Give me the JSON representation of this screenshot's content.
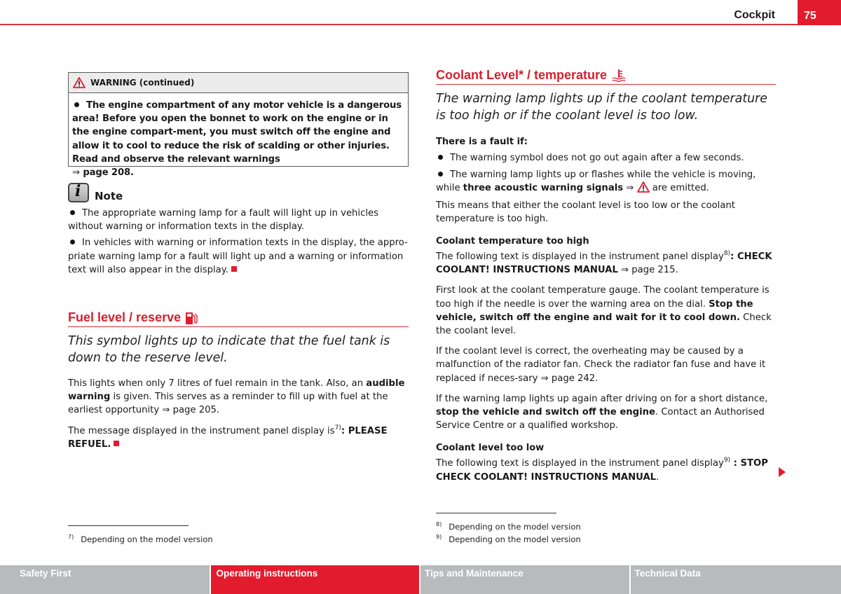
{
  "header": {
    "section_title": "Cockpit",
    "page_number": "75",
    "accent_color": "#e31c2d"
  },
  "warning_box": {
    "icon": "warning-triangle-icon",
    "title": "WARNING (continued)",
    "bullet_text": "The engine compartment of any motor vehicle is a dangerous area! Before you open the bonnet to work on the engine or in the engine compart-ment, you must switch off the engine and allow it to cool to reduce the risk of scalding or other injuries. Read and observe the relevant warnings",
    "ref_arrow": "⇒",
    "ref_page": "page 208."
  },
  "note": {
    "icon": "info-icon",
    "title": "Note",
    "items": [
      "The appropriate warning lamp for a fault will light up in vehicles without warning or information texts in the display.",
      "In vehicles with warning or information texts in the display, the appro-priate warning lamp for a fault will light up and a warning or information text will also appear in the display."
    ]
  },
  "fuel_section": {
    "title": "Fuel level / reserve",
    "icon": "fuel-pump-icon",
    "lead": "This symbol lights up to indicate that the fuel tank is down to the reserve level.",
    "p1_a": "This lights when only 7 litres of fuel remain in the tank. Also, an ",
    "p1_bold": "audible warning",
    "p1_b": " is given. This serves as a reminder to fill up with fuel at the earliest opportunity ",
    "p1_arrow": "⇒",
    "p1_page": " page 205.",
    "p2_a": "The message displayed in the instrument panel display is",
    "p2_sup": "7)",
    "p2_colon": ": ",
    "p2_bold": "PLEASE REFUEL",
    "p2_end": "."
  },
  "coolant_section": {
    "title": "Coolant Level* / temperature",
    "icon": "coolant-temperature-icon",
    "lead": "The warning lamp lights up if the coolant temperature is too high or if the coolant level is too low.",
    "fault_heading": "There is a fault if:",
    "fault_item1": "The warning symbol does not go out again after a few seconds.",
    "fault_item2_a": "The warning lamp lights up or flashes while the vehicle is moving, while ",
    "fault_item2_bold": "three acoustic warning signals",
    "fault_item2_arrow": " ⇒ ",
    "fault_item2_end": " are emitted.",
    "means": "This means that either the coolant level is too low or the coolant temperature is too high.",
    "temp_heading": "Coolant temperature too high",
    "temp_p1_a": "The following text is displayed in the instrument panel display",
    "temp_p1_sup": "8)",
    "temp_p1_colon": ": ",
    "temp_p1_bold": "CHECK COOLANT! INSTRUCTIONS MANUAL",
    "temp_p1_arrow": " ⇒ ",
    "temp_p1_page": "page 215.",
    "temp_p2_a": "First look at the coolant temperature gauge. The coolant temperature is too high if the needle is over the warning area on the dial. ",
    "temp_p2_bold": "Stop the vehicle, switch off the engine and wait for it to cool down.",
    "temp_p2_b": " Check the coolant level.",
    "temp_p3_a": "If the coolant level is correct, the overheating may be caused by a malfunction of the radiator fan. Check the radiator fan fuse and have it replaced if neces-sary ",
    "temp_p3_arrow": "⇒",
    "temp_p3_page": " page 242.",
    "temp_p4_a": "If the warning lamp lights up again after driving on for a short distance, ",
    "temp_p4_bold": "stop the vehicle and switch off the engine",
    "temp_p4_b": ". Contact an Authorised Service Centre or a qualified workshop.",
    "low_heading": "Coolant level too low",
    "low_p1_a": "The following text is displayed in the instrument panel display",
    "low_p1_sup": "9)",
    "low_p1_colon": " : ",
    "low_p1_bold": "STOP CHECK COOLANT! INSTRUCTIONS MANUAL",
    "low_p1_end": "."
  },
  "footnotes": {
    "left": [
      {
        "mark": "7)",
        "text": "Depending on the model version"
      }
    ],
    "right": [
      {
        "mark": "8)",
        "text": "Depending on the model version"
      },
      {
        "mark": "9)",
        "text": "Depending on the model version"
      }
    ]
  },
  "footer_tabs": [
    {
      "label": "Safety First",
      "active": false
    },
    {
      "label": "Operating instructions",
      "active": true
    },
    {
      "label": "Tips and Maintenance",
      "active": false
    },
    {
      "label": "Technical Data",
      "active": false
    }
  ]
}
